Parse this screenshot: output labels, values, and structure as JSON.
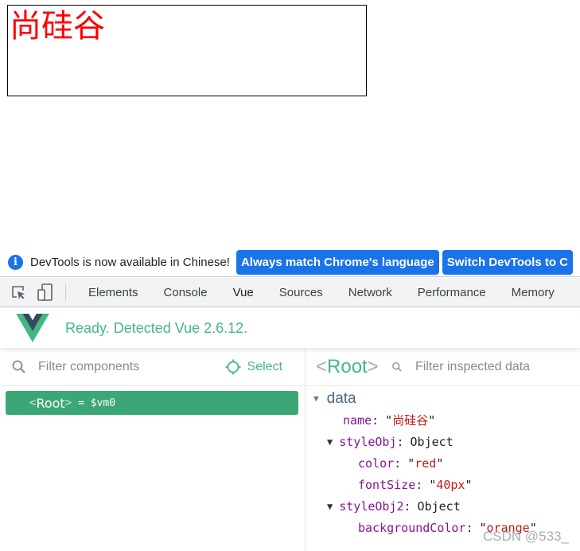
{
  "page": {
    "name_text": "尚硅谷",
    "name_color": "#ff0000"
  },
  "infobar": {
    "icon": "info-icon",
    "message": "DevTools is now available in Chinese!",
    "buttons": [
      "Always match Chrome's language",
      "Switch DevTools to C"
    ]
  },
  "tabbar": {
    "tools": [
      "inspect-element-icon",
      "device-toolbar-icon"
    ],
    "tabs": [
      "Elements",
      "Console",
      "Vue",
      "Sources",
      "Network",
      "Performance",
      "Memory"
    ],
    "active_tab": "Vue",
    "accent": "#1a73e8"
  },
  "vue": {
    "status": "Ready. Detected Vue 2.6.12.",
    "brand_green": "#42b983",
    "components": {
      "filter_placeholder": "Filter components",
      "select_label": "Select",
      "tree": [
        {
          "open": "<",
          "name": "Root",
          "close": ">",
          "ref": "= $vm0"
        }
      ]
    },
    "inspector": {
      "title_open": "<",
      "title": "Root",
      "title_close": ">",
      "filter_placeholder": "Filter inspected data",
      "section": "data",
      "fields": {
        "name": {
          "key": "name",
          "value": "尚硅谷"
        },
        "styleObj": {
          "key": "styleObj",
          "type": "Object",
          "children": [
            {
              "key": "color",
              "value": "red"
            },
            {
              "key": "fontSize",
              "value": "40px"
            }
          ]
        },
        "styleObj2": {
          "key": "styleObj2",
          "type": "Object",
          "children": [
            {
              "key": "backgroundColor",
              "value": "orange"
            }
          ]
        }
      }
    }
  },
  "watermark": "CSDN @533_"
}
